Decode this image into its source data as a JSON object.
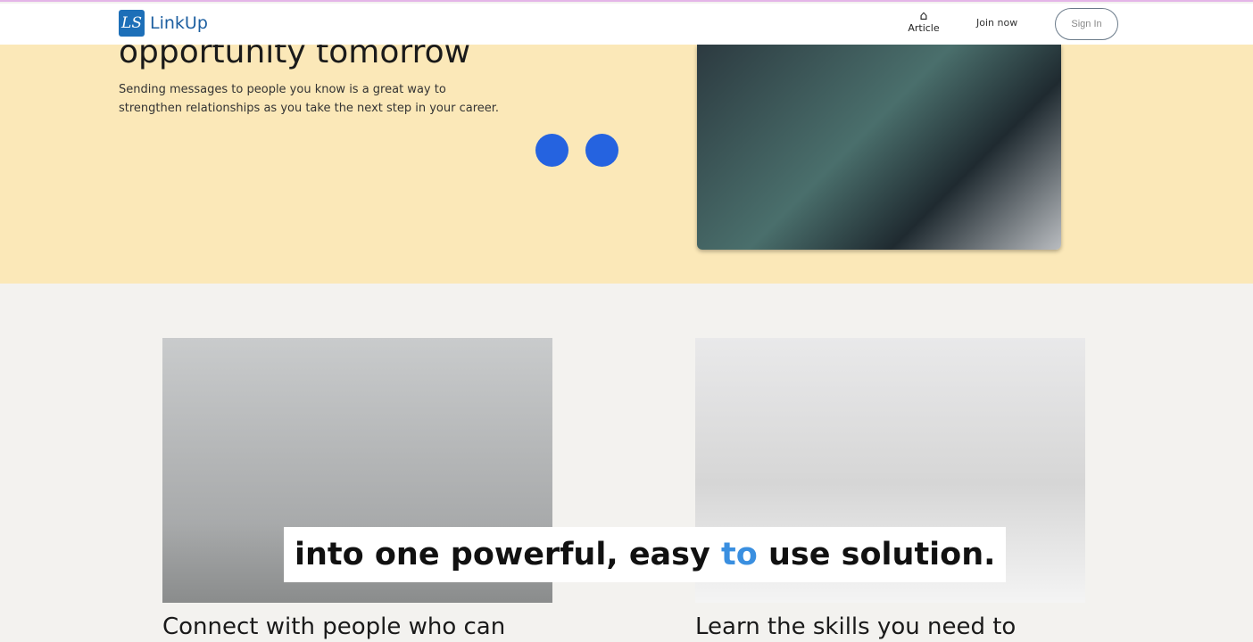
{
  "nav": {
    "logo_mark": "LS",
    "brand": "LinkUp",
    "article": "Article",
    "join": "Join now",
    "signin": "Sign In"
  },
  "hero": {
    "title": "opportunity tomorrow",
    "subtitle": "Sending messages to people you know is a great way to strengthen relationships as you take the next step in your career."
  },
  "cards": [
    {
      "title": "Connect with people who can"
    },
    {
      "title": "Learn the skills you need to"
    }
  ],
  "caption": {
    "before": "into one powerful, easy ",
    "highlight": "to",
    "after": " use solution."
  },
  "colors": {
    "accent": "#2563e0",
    "hero_bg": "#fbe8b8",
    "brand": "#1d6fb8"
  }
}
